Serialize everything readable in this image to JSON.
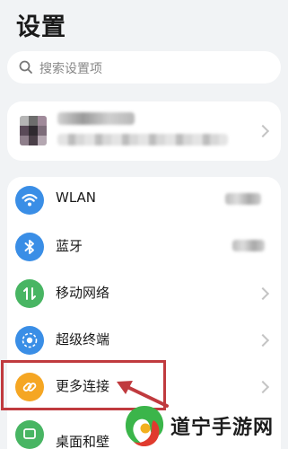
{
  "header": {
    "title": "设置"
  },
  "search": {
    "placeholder": "搜索设置项",
    "icon": "search-icon"
  },
  "account": {
    "icon": "avatar",
    "chevron": "chevron-right-icon"
  },
  "items": [
    {
      "label": "WLAN",
      "icon": "wifi-icon",
      "color": "#3a8ee6"
    },
    {
      "label": "蓝牙",
      "icon": "bluetooth-icon",
      "color": "#3a8ee6"
    },
    {
      "label": "移动网络",
      "icon": "mobile-network-icon",
      "color": "#48b563"
    },
    {
      "label": "超级终端",
      "icon": "super-device-icon",
      "color": "#3a8ee6"
    },
    {
      "label": "更多连接",
      "icon": "link-icon",
      "color": "#f5a623"
    },
    {
      "label": "桌面和壁",
      "icon": "desktop-icon",
      "color": "#48b563"
    }
  ],
  "annotation": {
    "highlight_color": "#c03a3e"
  },
  "watermark": {
    "text": "道宁手游网"
  }
}
